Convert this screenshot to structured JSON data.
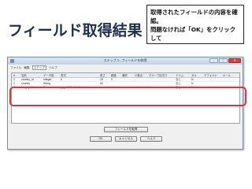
{
  "slide": {
    "title": "フィールド取得結果",
    "note": "取得されたフィールドの内容を確認。\n問題なければ「OK」をクリックして\n閉じる。"
  },
  "dialog": {
    "title": "ステップ 3 - フィールドを取得",
    "menu": [
      "ファイル",
      "編集",
      "ステップ",
      "ヘルプ"
    ],
    "toolbar": [
      "フィールドを取得",
      "行を追加",
      "結合",
      "クリア",
      "最適化"
    ],
    "columns": [
      "#",
      "名前",
      "データ型",
      "書式",
      "長さ",
      "精度",
      "通貨",
      "少数点",
      "グループ区切り",
      "トリム",
      "ヌル",
      "デフォルト",
      "ルール"
    ],
    "rows": [
      {
        "num": "1",
        "name": "country_id",
        "type": "Integer",
        "format": "#",
        "length": "15",
        "precision": "0",
        "decimal": ".",
        "trim": "なし",
        "null": "N"
      },
      {
        "num": "2",
        "name": "country",
        "type": "String",
        "format": "",
        "length": "50",
        "precision": "",
        "decimal": ".",
        "trim": "なし",
        "null": "N"
      },
      {
        "num": "3",
        "name": "last_update",
        "type": "Date",
        "format": "yyyy-MM-dd HH:mm:ss",
        "length": "",
        "precision": "",
        "decimal": "",
        "trim": "なし",
        "null": "N"
      }
    ],
    "buttons": {
      "preview": "フィールドを取得",
      "ok": "OK",
      "cancel": "キャンセル",
      "help": "ヘルプ"
    }
  }
}
